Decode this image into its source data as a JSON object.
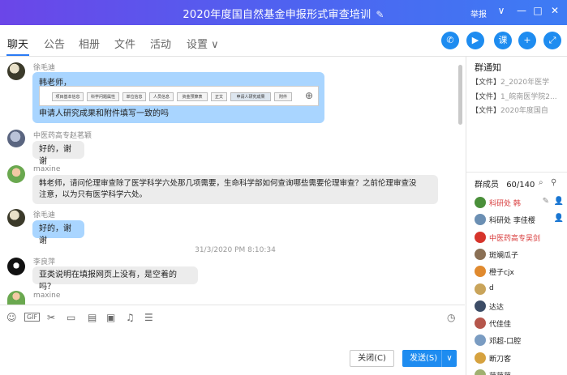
{
  "titlebar": {
    "title": "2020年度国自然基金申报形式审查培训",
    "report": "举报",
    "ctl_down": "∨",
    "ctl_min": "—",
    "ctl_max": "□",
    "ctl_close": "✕"
  },
  "tabs": [
    {
      "label": "聊天"
    },
    {
      "label": "公告"
    },
    {
      "label": "相册"
    },
    {
      "label": "文件"
    },
    {
      "label": "活动"
    },
    {
      "label": "设置 ∨"
    }
  ],
  "toolbar_buttons": [
    "✆",
    "▶",
    "课",
    "+",
    "⤢"
  ],
  "messages": [
    {
      "sender": "徐毛迪",
      "text1": "韩老师，",
      "text2": "申请人研究成果和附件填写一致的吗"
    },
    {
      "sender": "中医药高专赵茗颖",
      "text": "好的，谢谢"
    },
    {
      "sender": "maxine",
      "text1": "韩老师，请问伦理审查除了医学科学六处那几项需要，生命科学部如何查询哪些需要伦理审查？之前伦理审查没",
      "text2": "注意，以为只有医学科学六处。"
    },
    {
      "sender": "徐毛迪",
      "text": "好的，谢谢"
    },
    {
      "timestamp": "31/3/2020 PM 8:10:34"
    },
    {
      "sender": "李良萍",
      "text": "亚类说明在填报网页上没有，是空着的吗？"
    },
    {
      "sender": "maxine"
    }
  ],
  "embed_items": [
    "项目基本信息",
    "科学问题属性",
    "单位信息",
    "人员信息",
    "资金预算表",
    "正文",
    "申请人研究成果",
    "附件"
  ],
  "buttons": {
    "close": "关闭(C)",
    "send": "发送(S)",
    "send_arrow": "∨"
  },
  "side": {
    "notice_title": "群通知",
    "notices": [
      {
        "tag": "【文件】",
        "name": "2_2020年医学"
      },
      {
        "tag": "【文件】",
        "name": "1_皖南医学院2..."
      },
      {
        "tag": "【文件】",
        "name": "2020年度国自"
      }
    ],
    "members_label": "群成员",
    "members_count": "60/140",
    "members": [
      {
        "name": "科研处 韩",
        "color": "#d83b3b",
        "red": true,
        "avatar": "#4a8f3a"
      },
      {
        "name": "科研处 李佳樱",
        "color": "#222",
        "red": false,
        "avatar": "#6b8fb3"
      },
      {
        "name": "中医药高专吴剑",
        "color": "#d83b3b",
        "red": true,
        "avatar": "#d6342b"
      },
      {
        "name": "斑斓瓜子",
        "color": "#222",
        "red": false,
        "avatar": "#8a7055"
      },
      {
        "name": "橙子cjx",
        "color": "#222",
        "red": false,
        "avatar": "#e08a2f"
      },
      {
        "name": "d",
        "color": "#222",
        "red": false,
        "avatar": "#c9a45a"
      },
      {
        "name": "达达",
        "color": "#222",
        "red": false,
        "avatar": "#3c4c66"
      },
      {
        "name": "代佳佳",
        "color": "#222",
        "red": false,
        "avatar": "#b5564b"
      },
      {
        "name": "邓超-口腔",
        "color": "#222",
        "red": false,
        "avatar": "#7a9cc2"
      },
      {
        "name": "断刀客",
        "color": "#222",
        "red": false,
        "avatar": "#d6a23f"
      },
      {
        "name": "范范范",
        "color": "#222",
        "red": false,
        "avatar": "#a0b070"
      }
    ]
  }
}
